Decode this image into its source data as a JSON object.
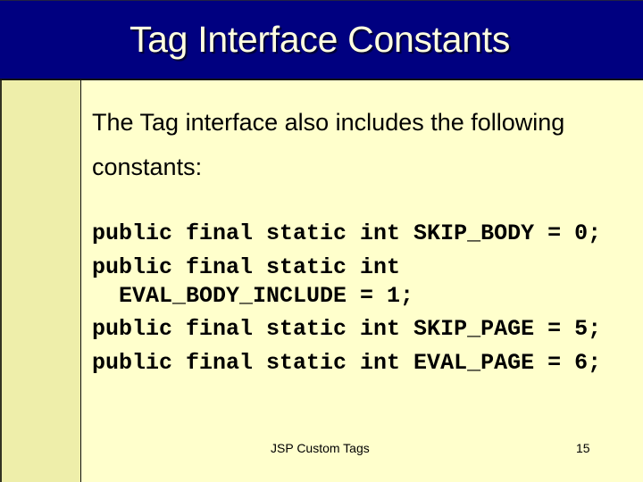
{
  "slide": {
    "title": "Tag Interface Constants",
    "intro_text": "The Tag interface also includes the following constants:",
    "code_lines": [
      "public final static int SKIP_BODY = 0;",
      "public final static int\n  EVAL_BODY_INCLUDE = 1;",
      "public final static int SKIP_PAGE = 5;",
      "public final static int EVAL_PAGE = 6;"
    ],
    "footer": {
      "caption": "JSP Custom Tags",
      "page_number": "15"
    }
  },
  "colors": {
    "title_bar": "#000080",
    "title_text": "#FFFFE0",
    "background": "#FFFFCC",
    "left_strip": "#EEEEAA",
    "body_text": "#000000"
  }
}
